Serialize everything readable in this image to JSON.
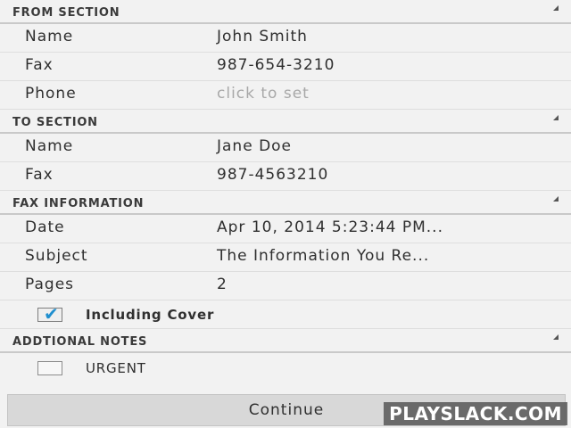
{
  "from_section": {
    "title": "FROM SECTION",
    "rows": [
      {
        "label": "Name",
        "value": "John Smith"
      },
      {
        "label": "Fax",
        "value": "987-654-3210"
      },
      {
        "label": "Phone",
        "value": "click to set"
      }
    ]
  },
  "to_section": {
    "title": "TO SECTION",
    "rows": [
      {
        "label": "Name",
        "value": "Jane Doe"
      },
      {
        "label": "Fax",
        "value": "987-4563210"
      }
    ]
  },
  "fax_information": {
    "title": "FAX INFORMATION",
    "rows": [
      {
        "label": "Date",
        "value": "Apr 10, 2014 5:23:44 PM..."
      },
      {
        "label": "Subject",
        "value": "The Information You Re..."
      },
      {
        "label": "Pages",
        "value": "2"
      }
    ],
    "including_cover": {
      "label": "Including Cover",
      "checked": true
    }
  },
  "additional_notes": {
    "title": "ADDTIONAL NOTES",
    "urgent": {
      "label": "URGENT",
      "checked": false
    }
  },
  "continue_label": "Continue",
  "watermark": "PLAYSLACK.COM",
  "colors": {
    "background": "#f2f2f2",
    "checkmark": "#1f8fcf",
    "button": "#d8d8d8"
  }
}
